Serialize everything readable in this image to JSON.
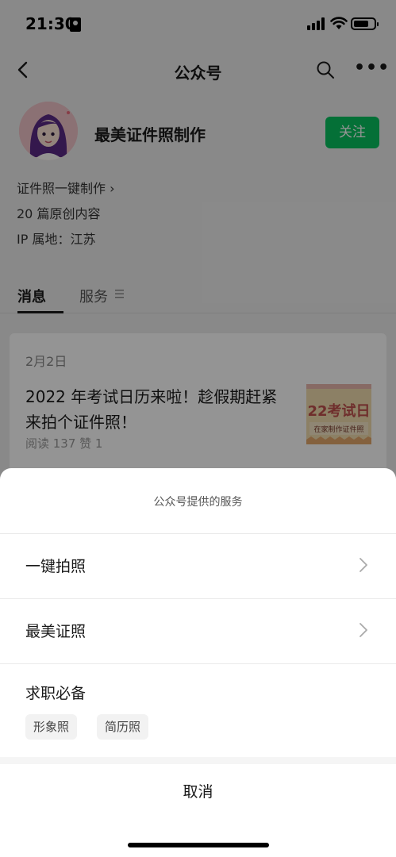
{
  "status_bar": {
    "time": "21:30"
  },
  "nav": {
    "title": "公众号"
  },
  "profile": {
    "name": "最美证件照制作",
    "follow_label": "关注",
    "link_text": "证件照一键制作 ›",
    "article_count": "20 篇原创内容",
    "ip_location": "IP 属地：江苏"
  },
  "tabs": [
    {
      "label": "消息"
    },
    {
      "label": "服务"
    }
  ],
  "article": {
    "date": "2月2日",
    "title": "2022 年考试日历来啦！趁假期赶紧来拍个证件照！",
    "stats": "阅读 137  赞 1",
    "thumbnail_text_top": "22考试日",
    "thumbnail_text_bottom": "在家制作证件照"
  },
  "sheet": {
    "title": "公众号提供的服务",
    "items": [
      {
        "label": "一键拍照"
      },
      {
        "label": "最美证照"
      }
    ],
    "job_section": {
      "label": "求职必备",
      "chips": [
        "形象照",
        "简历照"
      ]
    },
    "cancel_label": "取消"
  },
  "colors": {
    "accent_green": "#07c160",
    "overlay": "rgba(0,0,0,0.42)"
  }
}
